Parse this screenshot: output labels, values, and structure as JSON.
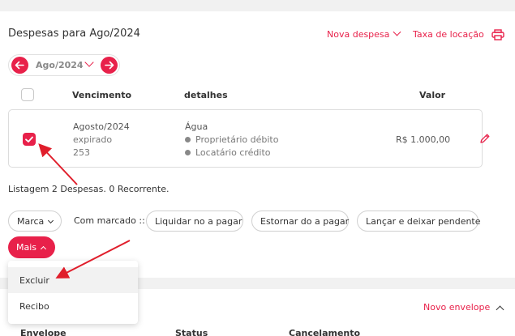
{
  "header": {
    "title": "Despesas para Ago/2024",
    "nova_despesa": "Nova despesa",
    "taxa_locacao": "Taxa de locação"
  },
  "period": {
    "label": "Ago/2024"
  },
  "table": {
    "headers": [
      "Vencimento",
      "detalhes",
      "Valor"
    ],
    "row": {
      "vencimento": "Agosto/2024",
      "status": "expirado",
      "code": "253",
      "detail_title": "Água",
      "detail_1": "Proprietário débito",
      "detail_2": "Locatário crédito",
      "valor": "R$ 1.000,00"
    }
  },
  "listing_text": "Listagem 2 Despesas. 0 Recorrente.",
  "actions": {
    "marca": "Marca",
    "com_marcado": "Com marcado ::",
    "liquidar": "Liquidar no a pagar",
    "estornar": "Estornar do a pagar",
    "lancar": "Lançar e deixar pendente",
    "mais": "Mais"
  },
  "dropdown": {
    "items": [
      "Excluir",
      "Recibo"
    ]
  },
  "envelope": {
    "novo_envelope": "Novo envelope",
    "headers": [
      "Envelope",
      "Status",
      "Cancelamento"
    ]
  },
  "colors": {
    "accent": "#e8214a",
    "annotation_arrow": "#e01e2b"
  }
}
